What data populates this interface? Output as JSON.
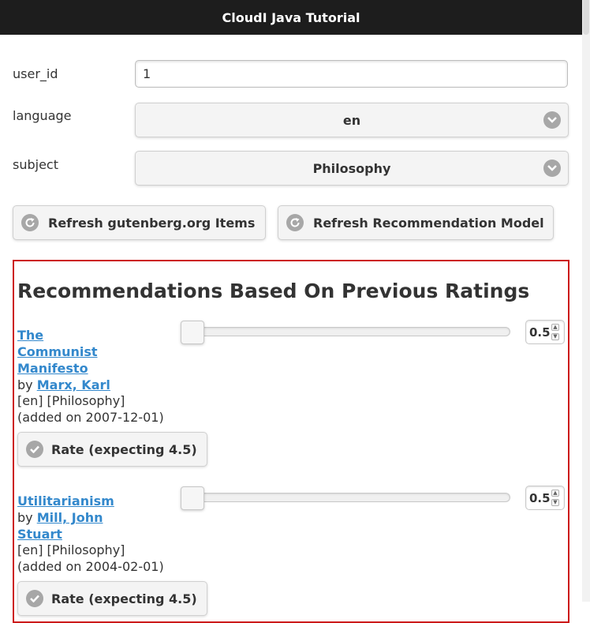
{
  "header": {
    "title": "CloudI Java Tutorial"
  },
  "form": {
    "user_id": {
      "label": "user_id",
      "value": "1"
    },
    "language": {
      "label": "language",
      "selected": "en"
    },
    "subject": {
      "label": "subject",
      "selected": "Philosophy"
    }
  },
  "buttons": {
    "refresh_items": "Refresh gutenberg.org Items",
    "refresh_model": "Refresh Recommendation Model"
  },
  "recommendations": {
    "title": "Recommendations Based On Previous Ratings",
    "items": [
      {
        "title": "The Communist Manifesto",
        "by": "by",
        "author": "Marx, Karl",
        "tags": "[en] [Philosophy]",
        "added": "(added on 2007-12-01)",
        "rating_value": "0.5",
        "rate_label": "Rate (expecting 4.5)"
      },
      {
        "title": "Utilitarianism",
        "by": "by",
        "author": "Mill, John Stuart",
        "tags": "[en] [Philosophy]",
        "added": "(added on 2004-02-01)",
        "rating_value": "0.5",
        "rate_label": "Rate (expecting 4.5)"
      }
    ]
  },
  "icons": {
    "select_chevron": "chevron-down-icon",
    "refresh": "refresh-icon",
    "rate": "check-icon"
  },
  "colors": {
    "header_bg": "#1d1d1d",
    "link": "#3388cc",
    "box_border": "#cc1a1a"
  }
}
